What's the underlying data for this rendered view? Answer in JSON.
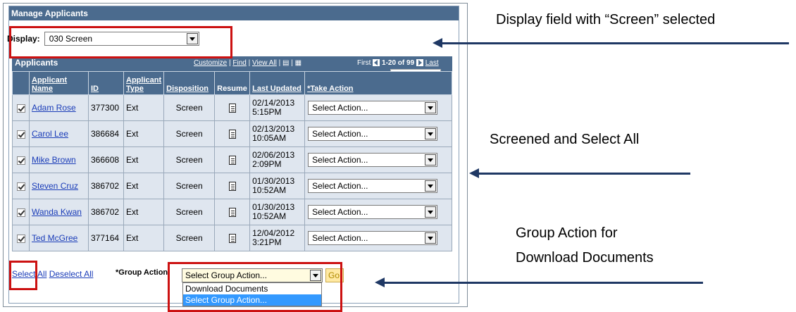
{
  "panel": {
    "title": "Manage Applicants",
    "display_label": "Display:",
    "display_value": "030 Screen"
  },
  "grid": {
    "title": "Applicants",
    "customize": "Customize",
    "find": "Find",
    "view_all": "View All",
    "first": "First",
    "range": "1-20 of 99",
    "last": "Last",
    "headers": {
      "name": "Applicant Name",
      "id": "ID",
      "type": "Applicant Type",
      "disposition": "Disposition",
      "resume": "Resume",
      "updated": "Last Updated",
      "action": "*Take Action"
    },
    "rows": [
      {
        "name": "Adam Rose",
        "id": "377300",
        "type": "Ext",
        "disposition": "Screen",
        "date": "02/14/2013",
        "time": "5:15PM",
        "action": "Select Action..."
      },
      {
        "name": "Carol Lee",
        "id": "386684",
        "type": "Ext",
        "disposition": "Screen",
        "date": "02/13/2013",
        "time": "10:05AM",
        "action": "Select Action..."
      },
      {
        "name": "Mike Brown",
        "id": "366608",
        "type": "Ext",
        "disposition": "Screen",
        "date": "02/06/2013",
        "time": "2:09PM",
        "action": "Select Action..."
      },
      {
        "name": "Steven Cruz",
        "id": "386702",
        "type": "Ext",
        "disposition": "Screen",
        "date": "01/30/2013",
        "time": "10:52AM",
        "action": "Select Action..."
      },
      {
        "name": "Wanda Kwan",
        "id": "386702",
        "type": "Ext",
        "disposition": "Screen",
        "date": "01/30/2013",
        "time": "10:52AM",
        "action": "Select Action..."
      },
      {
        "name": "Ted McGree",
        "id": "377164",
        "type": "Ext",
        "disposition": "Screen",
        "date": "12/04/2012",
        "time": "3:21PM",
        "action": "Select Action..."
      }
    ]
  },
  "bottom": {
    "select_all": "Select All",
    "deselect_all": "Deselect All",
    "group_action_label": "*Group Action:",
    "group_action_value": "Select Group Action...",
    "go": "Go",
    "options": [
      "Download Documents",
      "Select Group Action..."
    ]
  },
  "annotations": {
    "display": "Display field with “Screen” selected",
    "screened": "Screened and Select All",
    "group_line1": "Group Action for",
    "group_line2": "Download Documents"
  },
  "colors": {
    "header_blue": "#4b6b8e",
    "row_bg": "#dfe6ef",
    "highlight_red": "#cc1111",
    "arrow_navy": "#1f3864",
    "link_blue": "#1a3cb8"
  }
}
